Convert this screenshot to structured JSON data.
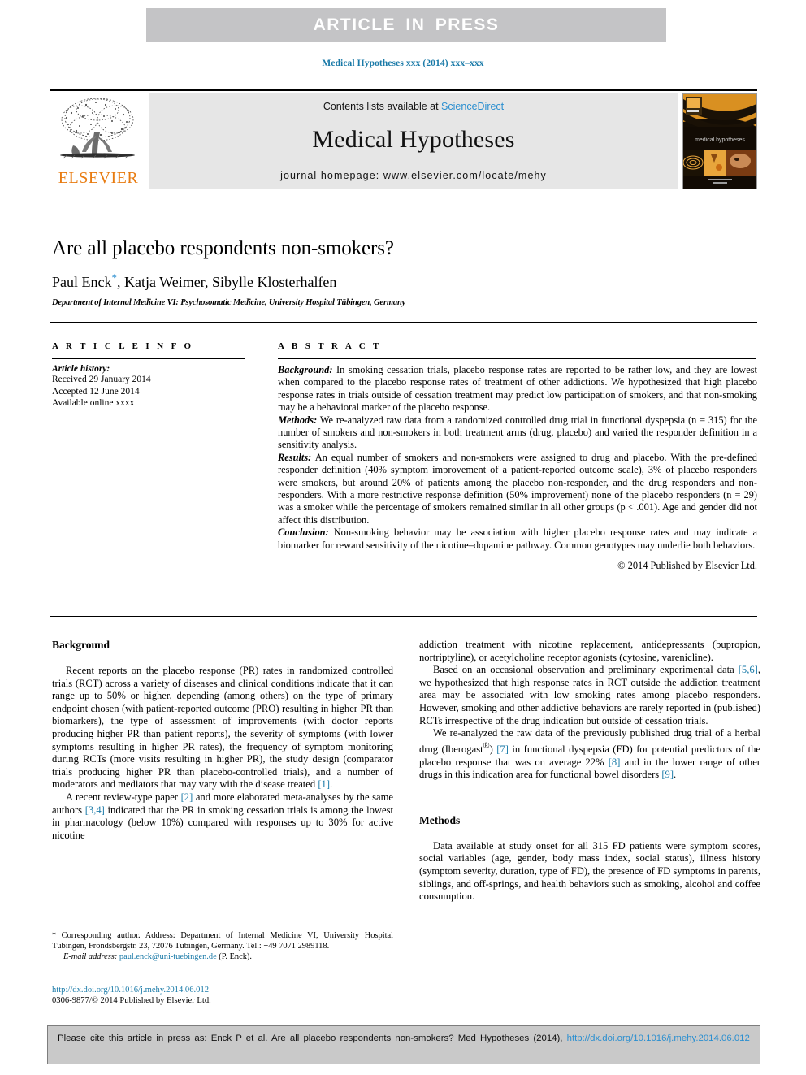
{
  "banner": {
    "text": "ARTICLE  IN  PRESS"
  },
  "running_head": "Medical Hypotheses xxx (2014) xxx–xxx",
  "masthead": {
    "contents_prefix": "Contents lists available at ",
    "contents_link": "ScienceDirect",
    "journal_name": "Medical Hypotheses",
    "homepage": "journal homepage: www.elsevier.com/locate/mehy",
    "publisher_wordmark": "ELSEVIER",
    "cover_caption": "medical hypotheses"
  },
  "article": {
    "title": "Are all placebo respondents non-smokers?",
    "authors": "Paul Enck , Katja Weimer, Sibylle Klosterhalfen",
    "authors_lead": "Paul Enck",
    "authors_rest": ", Katja Weimer, Sibylle Klosterhalfen",
    "corresponding_marker": "*",
    "affiliation": "Department of Internal Medicine VI: Psychosomatic Medicine, University Hospital Tübingen, Germany"
  },
  "article_info": {
    "kicker": "A R T I C L E    I N F O",
    "history_label": "Article history:",
    "history": [
      "Received 29 January 2014",
      "Accepted 12 June 2014",
      "Available online xxxx"
    ]
  },
  "abstract": {
    "kicker": "A B S T R A C T",
    "sections": [
      {
        "label": "Background:",
        "text": " In smoking cessation trials, placebo response rates are reported to be rather low, and they are lowest when compared to the placebo response rates of treatment of other addictions. We hypothesized that high placebo response rates in trials outside of cessation treatment may predict low participation of smokers, and that non-smoking may be a behavioral marker of the placebo response."
      },
      {
        "label": "Methods:",
        "text": " We re-analyzed raw data from a randomized controlled drug trial in functional dyspepsia (n = 315) for the number of smokers and non-smokers in both treatment arms (drug, placebo) and varied the responder definition in a sensitivity analysis."
      },
      {
        "label": "Results:",
        "text": " An equal number of smokers and non-smokers were assigned to drug and placebo. With the pre-defined responder definition (40% symptom improvement of a patient-reported outcome scale), 3% of placebo responders were smokers, but around 20% of patients among the placebo non-responder, and the drug responders and non-responders. With a more restrictive response definition (50% improvement) none of the placebo responders (n = 29) was a smoker while the percentage of smokers remained similar in all other groups (p < .001). Age and gender did not affect this distribution."
      },
      {
        "label": "Conclusion:",
        "text": " Non-smoking behavior may be association with higher placebo response rates and may indicate a biomarker for reward sensitivity of the nicotine–dopamine pathway. Common genotypes may underlie both behaviors."
      }
    ],
    "copyright": "© 2014 Published by Elsevier Ltd."
  },
  "body": {
    "left_column": {
      "heading": "Background",
      "paragraph_1": "Recent reports on the placebo response (PR) rates in randomized controlled trials (RCT) across a variety of diseases and clinical conditions indicate that it can range up to 50% or higher, depending (among others) on the type of primary endpoint chosen (with patient-reported outcome (PRO) resulting in higher PR than biomarkers), the type of assessment of improvements (with doctor reports producing higher PR than patient reports), the severity of symptoms (with lower symptoms resulting in higher PR rates), the frequency of symptom monitoring during RCTs (more visits resulting in higher PR), the study design (comparator trials producing higher PR than placebo-controlled trials), and a number of moderators and mediators that may vary with the disease treated ",
      "paragraph_1_ref": "[1]",
      "paragraph_1_tail": ".",
      "paragraph_2_a": "A recent review-type paper ",
      "paragraph_2_ref1": "[2]",
      "paragraph_2_b": " and more elaborated meta-analyses by the same authors ",
      "paragraph_2_ref2": "[3,4]",
      "paragraph_2_c": " indicated that the PR in smoking cessation trials is among the lowest in pharmacology (below 10%) compared with responses up to 30% for active nicotine"
    },
    "right_column": {
      "paragraph_1": "addiction treatment with nicotine replacement, antidepressants (bupropion, nortriptyline), or acetylcholine receptor agonists (cytosine, varenicline).",
      "paragraph_2_a": "Based on an occasional observation and preliminary experimental data ",
      "paragraph_2_ref": "[5,6]",
      "paragraph_2_b": ", we hypothesized that high response rates in RCT outside the addiction treatment area may be associated with low smoking rates among placebo responders. However, smoking and other addictive behaviors are rarely reported in (published) RCTs irrespective of the drug indication but outside of cessation trials.",
      "paragraph_3_a": "We re-analyzed the raw data of the previously published drug trial of a herbal drug (Iberogast",
      "paragraph_3_sup": "®",
      "paragraph_3_b": ") ",
      "paragraph_3_ref1": "[7]",
      "paragraph_3_c": " in functional dyspepsia (FD) for potential predictors of the placebo response that was on average 22% ",
      "paragraph_3_ref2": "[8]",
      "paragraph_3_d": " and in the lower range of other drugs in this indication area for functional bowel disorders ",
      "paragraph_3_ref3": "[9]",
      "paragraph_3_e": ".",
      "methods_heading": "Methods",
      "methods_paragraph": "Data available at study onset for all 315 FD patients were symptom scores, social variables (age, gender, body mass index, social status), illness history (symptom severity, duration, type of FD), the presence of FD symptoms in parents, siblings, and off-springs, and health behaviors such as smoking, alcohol and coffee consumption."
    }
  },
  "footnote": {
    "corresponding_marker": "*",
    "corresponding_text": " Corresponding author. Address: Department of Internal Medicine VI, University Hospital Tübingen, Frondsbergstr. 23, 72076 Tübingen, Germany. Tel.: +49 7071 2989118.",
    "email_label": "E-mail address:",
    "email": "paul.enck@uni-tuebingen.de",
    "email_owner": " (P. Enck)."
  },
  "doi_block": {
    "doi_url": "http://dx.doi.org/10.1016/j.mehy.2014.06.012",
    "issn_line": "0306-9877/© 2014 Published by Elsevier Ltd."
  },
  "cite_footer": {
    "text": "Please cite this article in press as: Enck P et al. Are all placebo respondents non-smokers? Med Hypotheses (2014), ",
    "link_1": "http://dx.doi.org/10.1016/",
    "link_2": "j.mehy.2014.06.012"
  },
  "colors": {
    "banner_bg": "#c4c4c6",
    "link_blue": "#2b8fd0",
    "ref_blue": "#1a7aa8",
    "elsevier_orange": "#E87B10",
    "masthead_grey": "#e6e6e6",
    "cite_grey": "#c9c9c9"
  }
}
